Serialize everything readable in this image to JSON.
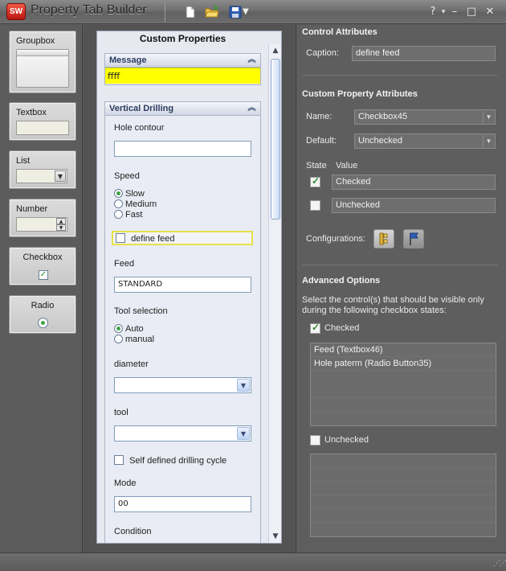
{
  "app": {
    "title": "Property Tab Builder",
    "logo_text": "SW",
    "icons": [
      "new-file-icon",
      "open-folder-icon",
      "save-icon",
      "dropdown-arrow-icon"
    ],
    "window_controls": {
      "help": "?",
      "help_menu": "▾",
      "minimize": "–",
      "maximize": "□",
      "close": "✕"
    }
  },
  "toolbox": {
    "items": [
      {
        "label": "Groupbox"
      },
      {
        "label": "Textbox"
      },
      {
        "label": "List"
      },
      {
        "label": "Number"
      },
      {
        "label": "Checkbox"
      },
      {
        "label": "Radio"
      }
    ]
  },
  "custom_properties": {
    "title": "Custom Properties",
    "message_group": {
      "title": "Message",
      "text": "ffff",
      "color": "#ffff00"
    },
    "vertical_drilling": {
      "title": "Vertical Drilling",
      "hole_contour_label": "Hole contour",
      "hole_contour_value": "",
      "speed_label": "Speed",
      "speed_options": [
        "Slow",
        "Medium",
        "Fast"
      ],
      "speed_selected": "Slow",
      "define_feed_label": "define feed",
      "define_feed_checked": false,
      "feed_label": "Feed",
      "feed_value": "STANDARD",
      "tool_selection_label": "Tool selection",
      "tool_selection_options": [
        "Auto",
        "manual"
      ],
      "tool_selection_selected": "Auto",
      "diameter_label": "diameter",
      "tool_label": "tool",
      "self_defined_label": "Self defined drilling cycle",
      "mode_label": "Mode",
      "mode_value": "00",
      "condition_label": "Condition"
    }
  },
  "control_attributes": {
    "heading": "Control Attributes",
    "caption_label": "Caption:",
    "caption_value": "define feed"
  },
  "custom_property_attributes": {
    "heading": "Custom Property Attributes",
    "name_label": "Name:",
    "name_value": "Checkbox45",
    "default_label": "Default:",
    "default_value": "Unchecked",
    "state_header": "State",
    "value_header": "Value",
    "states": [
      {
        "checked": true,
        "value": "Checked"
      },
      {
        "checked": false,
        "value": "Unchecked"
      }
    ],
    "configurations_label": "Configurations:"
  },
  "advanced_options": {
    "heading": "Advanced Options",
    "description": "Select the control(s) that should be visible only during the following checkbox states:",
    "checked_label": "Checked",
    "checked_state": true,
    "checked_list": [
      "Feed (Textbox46)",
      "Hole paterm (Radio Button35)"
    ],
    "unchecked_label": "Unchecked",
    "unchecked_state": false,
    "unchecked_list": []
  }
}
